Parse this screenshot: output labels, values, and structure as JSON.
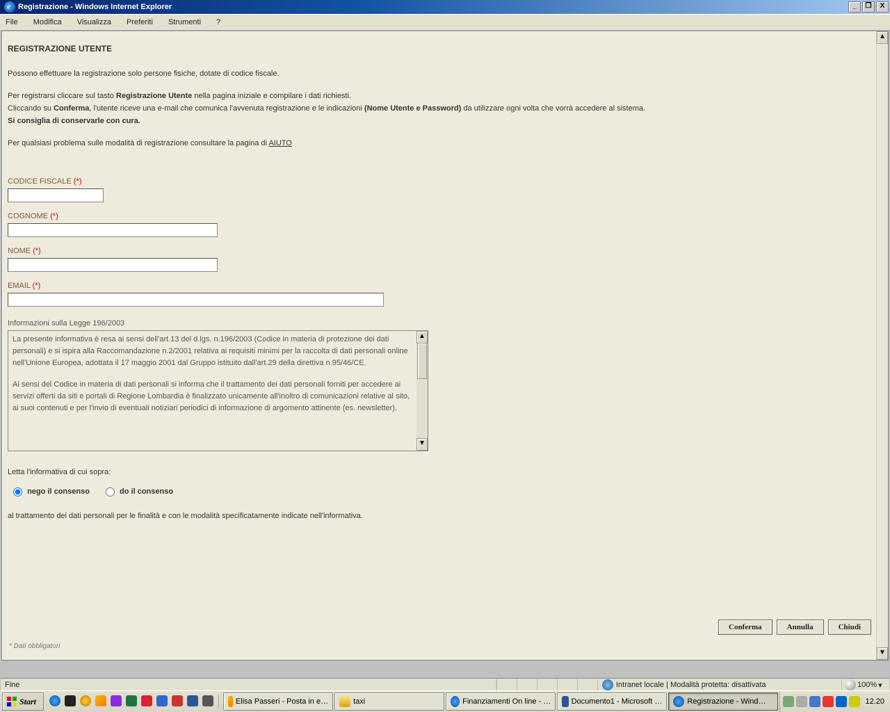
{
  "window": {
    "title": "Registrazione - Windows Internet Explorer",
    "min": "_",
    "max": "❐",
    "close": "X"
  },
  "menubar": [
    "File",
    "Modifica",
    "Visualizza",
    "Preferiti",
    "Strumenti",
    "?"
  ],
  "page": {
    "heading": "REGISTRAZIONE UTENTE",
    "p1": "Possono effettuare la registrazione solo persone fisiche, dotate di codice fiscale.",
    "p2a": "Per registrarsi cliccare sul tasto ",
    "p2b": "Registrazione Utente",
    "p2c": " nella pagina iniziale e compilare i dati richiesti.",
    "p3a": "Cliccando su ",
    "p3b": "Conferma",
    "p3c": ", l'utente riceve una e-mail che comunica l'avvenuta registrazione e le indicazioni ",
    "p3d": "(Nome Utente e Password)",
    "p3e": " da utilizzare ogni volta che vorrà accedere al sistema.",
    "p4": "Si consiglia di conservarle con cura.",
    "p5a": "Per qualsiasi problema sulle modalità di registrazione consultare la pagina di ",
    "p5link": "AIUTO"
  },
  "fields": {
    "cf": "CODICE FISCALE ",
    "cognome": "COGNOME ",
    "nome": "NOME ",
    "email": "EMAIL ",
    "req": "(*)",
    "info_label": "Informazioni sulla Legge 196/2003",
    "info_text_p1": "La presente informativa è resa ai sensi dell'art.13 del d.lgs. n.196/2003 (Codice in materia di protezione dei dati personali) e si ispira alla Raccomandazione n.2/2001 relativa ai requisiti minimi per la raccolta di dati personali online nell'Unione Europea, adottata il 17 maggio 2001 dal Gruppo istituito dall'art.29 della direttiva n.95/46/CE.",
    "info_text_p2": "Ai sensi del Codice in materia di dati personali si informa che il trattamento dei dati personali forniti per accedere ai servizi offerti da siti e portali di Regione Lombardia è finalizzato unicamente all'inoltro di comunicazioni relative al sito, ai suoi contenuti e per l'invio di eventuali notiziari periodici di informazione di argomento attinente (es. newsletter)."
  },
  "consent": {
    "intro": "Letta l'informativa di cui sopra:",
    "nego": "nego il consenso",
    "do": "do il consenso",
    "below": "al trattamento dei dati personali per le finalità e con le modalità specificatamente indicate nell'informativa."
  },
  "buttons": {
    "conferma": "Conferma",
    "annulla": "Annulla",
    "chiudi": "Chiudi"
  },
  "footnote": "* Dati obbligatori",
  "status": {
    "left": "Fine",
    "zone": "Intranet locale | Modalità protetta: disattivata",
    "zoom": "100%"
  },
  "taskbar": {
    "start": "Start",
    "tasks": [
      {
        "label": "Elisa Passeri - Posta in e…",
        "active": false,
        "icon": "ol"
      },
      {
        "label": "taxi",
        "active": false,
        "icon": "fold"
      },
      {
        "label": "Finanziamenti On line - …",
        "active": false,
        "icon": "ie"
      },
      {
        "label": "Documento1 - Microsoft …",
        "active": false,
        "icon": "word"
      },
      {
        "label": "Registrazione - Wind…",
        "active": true,
        "icon": "ie"
      }
    ],
    "clock": "12.20"
  }
}
